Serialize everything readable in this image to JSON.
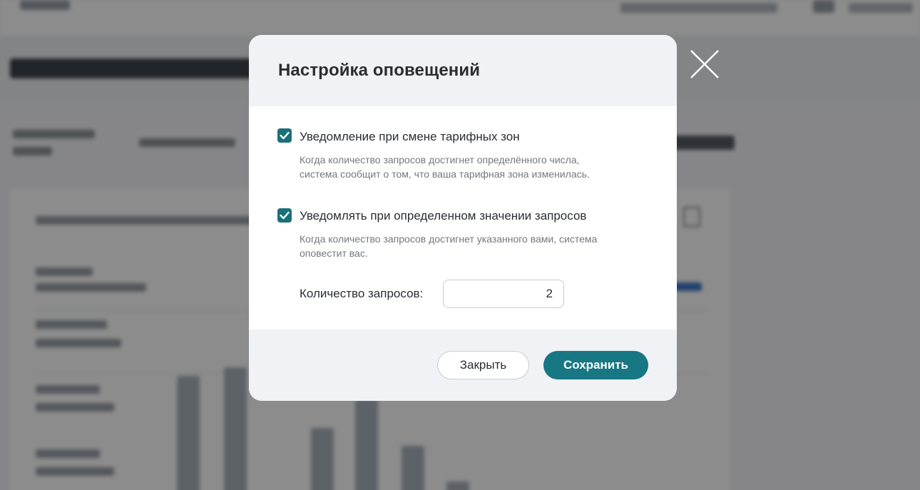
{
  "dialog": {
    "title": "Настройка оповещений",
    "close_icon": "close-icon",
    "options": [
      {
        "checked": true,
        "label": "Уведомление при смене тарифных зон",
        "description_line1": "Когда количество запросов достигнет определённого числа,",
        "description_line2": "система сообщит о том, что ваша тарифная зона изменилась."
      },
      {
        "checked": true,
        "label": "Уведомлять при определенном значении запросов",
        "description_line1": "Когда количество запросов достигнет указанного вами, система",
        "description_line2": "оповестит вас."
      }
    ],
    "quantity": {
      "label": "Количество запросов:",
      "value": "2"
    },
    "buttons": {
      "close_label": "Закрыть",
      "save_label": "Сохранить"
    }
  },
  "colors": {
    "accent": "#177783",
    "checkbox": "#18707a",
    "overlay": "rgba(0,0,0,0.45)"
  }
}
